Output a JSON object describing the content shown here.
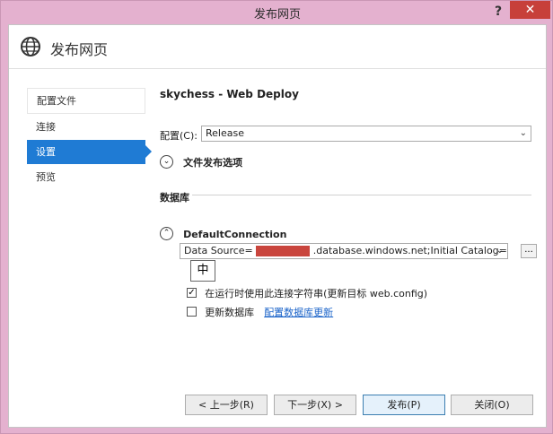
{
  "window": {
    "title": "发布网页",
    "help_label": "?",
    "close_label": "✕"
  },
  "header": {
    "title": "发布网页"
  },
  "nav": {
    "items": [
      {
        "label": "配置文件"
      },
      {
        "label": "连接"
      },
      {
        "label": "设置"
      },
      {
        "label": "预览"
      }
    ]
  },
  "content": {
    "profile_title": "skychess - Web Deploy",
    "config": {
      "label": "配置(C):",
      "value": "Release"
    },
    "file_publish_options": {
      "label": "文件发布选项"
    },
    "database_section": {
      "label": "数据库"
    },
    "connection": {
      "name": "DefaultConnection",
      "value": "Data Source=",
      "value_suffix": ".database.windows.net;Initial Catalog=aspne",
      "browse_label": "...",
      "ime_label": "中",
      "use_at_runtime": {
        "label": "在运行时使用此连接字符串(更新目标 web.config)",
        "checked": true
      },
      "update_db": {
        "label": "更新数据库",
        "checked": false
      },
      "configure_link": "配置数据库更新"
    }
  },
  "footer": {
    "prev_label": "< 上一步(R)",
    "next_label": "下一步(X) >",
    "publish_label": "发布(P)",
    "close_label": "关闭(O)"
  }
}
